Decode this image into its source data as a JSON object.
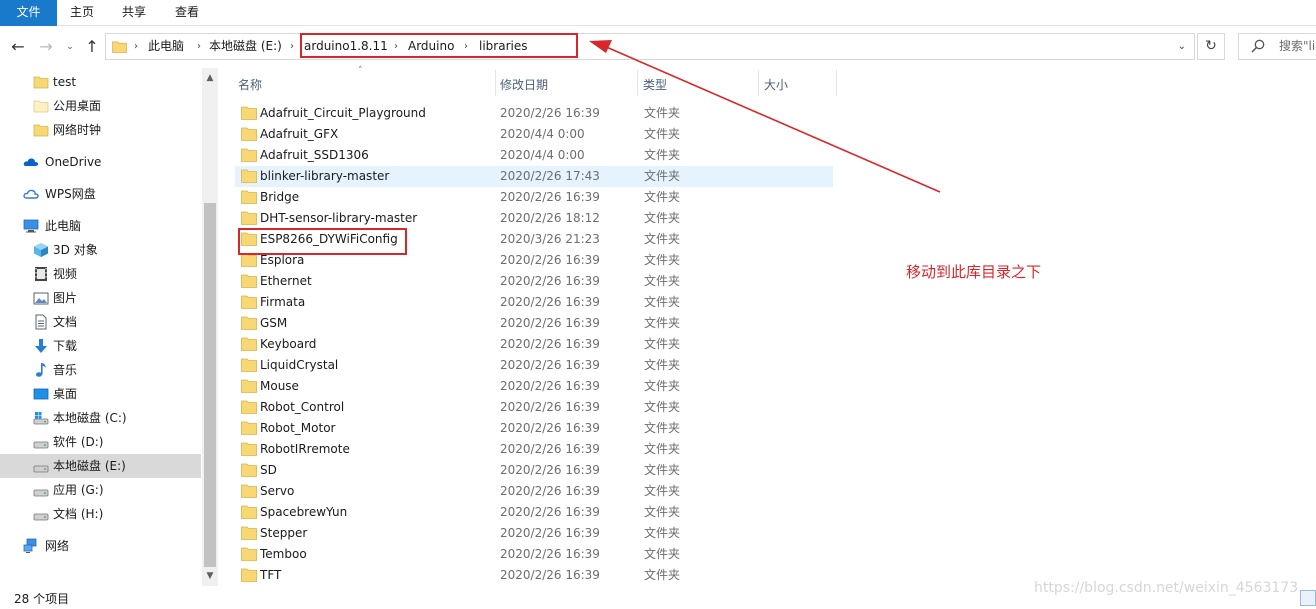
{
  "ribbon": {
    "tabs": [
      "文件",
      "主页",
      "共享",
      "查看"
    ]
  },
  "address": {
    "crumbs": [
      "此电脑",
      "本地磁盘 (E:)",
      "arduino1.8.11",
      "Arduino",
      "libraries"
    ]
  },
  "search": {
    "placeholder": "搜索\"li"
  },
  "sidebar": {
    "items": [
      {
        "label": "test",
        "icon": "folder-icon"
      },
      {
        "label": "公用桌面",
        "icon": "folder-pale-icon"
      },
      {
        "label": "网络时钟",
        "icon": "folder-icon"
      },
      {
        "label": "OneDrive",
        "icon": "onedrive-cloud-icon"
      },
      {
        "label": "WPS网盘",
        "icon": "wps-cloud-icon"
      },
      {
        "label": "此电脑",
        "icon": "computer-icon"
      },
      {
        "label": "3D 对象",
        "icon": "cube-3d-icon"
      },
      {
        "label": "视频",
        "icon": "video-icon"
      },
      {
        "label": "图片",
        "icon": "picture-icon"
      },
      {
        "label": "文档",
        "icon": "document-icon"
      },
      {
        "label": "下载",
        "icon": "download-arrow-icon"
      },
      {
        "label": "音乐",
        "icon": "music-note-icon"
      },
      {
        "label": "桌面",
        "icon": "desktop-icon"
      },
      {
        "label": "本地磁盘 (C:)",
        "icon": "drive-windows-icon"
      },
      {
        "label": "软件 (D:)",
        "icon": "drive-icon"
      },
      {
        "label": "本地磁盘 (E:)",
        "icon": "drive-icon"
      },
      {
        "label": "应用 (G:)",
        "icon": "drive-icon"
      },
      {
        "label": "文档 (H:)",
        "icon": "drive-icon"
      },
      {
        "label": "网络",
        "icon": "network-icon"
      }
    ]
  },
  "columns": {
    "name": "名称",
    "date": "修改日期",
    "type": "类型",
    "size": "大小"
  },
  "files": [
    {
      "name": "Adafruit_Circuit_Playground",
      "date": "2020/2/26 16:39",
      "type": "文件夹"
    },
    {
      "name": "Adafruit_GFX",
      "date": "2020/4/4 0:00",
      "type": "文件夹"
    },
    {
      "name": "Adafruit_SSD1306",
      "date": "2020/4/4 0:00",
      "type": "文件夹"
    },
    {
      "name": "blinker-library-master",
      "date": "2020/2/26 17:43",
      "type": "文件夹"
    },
    {
      "name": "Bridge",
      "date": "2020/2/26 16:39",
      "type": "文件夹"
    },
    {
      "name": "DHT-sensor-library-master",
      "date": "2020/2/26 18:12",
      "type": "文件夹"
    },
    {
      "name": "ESP8266_DYWiFiConfig",
      "date": "2020/3/26 21:23",
      "type": "文件夹"
    },
    {
      "name": "Esplora",
      "date": "2020/2/26 16:39",
      "type": "文件夹"
    },
    {
      "name": "Ethernet",
      "date": "2020/2/26 16:39",
      "type": "文件夹"
    },
    {
      "name": "Firmata",
      "date": "2020/2/26 16:39",
      "type": "文件夹"
    },
    {
      "name": "GSM",
      "date": "2020/2/26 16:39",
      "type": "文件夹"
    },
    {
      "name": "Keyboard",
      "date": "2020/2/26 16:39",
      "type": "文件夹"
    },
    {
      "name": "LiquidCrystal",
      "date": "2020/2/26 16:39",
      "type": "文件夹"
    },
    {
      "name": "Mouse",
      "date": "2020/2/26 16:39",
      "type": "文件夹"
    },
    {
      "name": "Robot_Control",
      "date": "2020/2/26 16:39",
      "type": "文件夹"
    },
    {
      "name": "Robot_Motor",
      "date": "2020/2/26 16:39",
      "type": "文件夹"
    },
    {
      "name": "RobotIRremote",
      "date": "2020/2/26 16:39",
      "type": "文件夹"
    },
    {
      "name": "SD",
      "date": "2020/2/26 16:39",
      "type": "文件夹"
    },
    {
      "name": "Servo",
      "date": "2020/2/26 16:39",
      "type": "文件夹"
    },
    {
      "name": "SpacebrewYun",
      "date": "2020/2/26 16:39",
      "type": "文件夹"
    },
    {
      "name": "Stepper",
      "date": "2020/2/26 16:39",
      "type": "文件夹"
    },
    {
      "name": "Temboo",
      "date": "2020/2/26 16:39",
      "type": "文件夹"
    },
    {
      "name": "TFT",
      "date": "2020/2/26 16:39",
      "type": "文件夹"
    }
  ],
  "annotation": {
    "text": "移动到此库目录之下",
    "color": "#d9262b"
  },
  "status": {
    "count": "28 个项目"
  },
  "watermark": "https://blog.csdn.net/weixin_4563173",
  "colors": {
    "file_tab": "#1979ca",
    "hover_row": "#e5f3ff",
    "selected_nav": "#d9d9d9",
    "folder": "#f8d775"
  }
}
